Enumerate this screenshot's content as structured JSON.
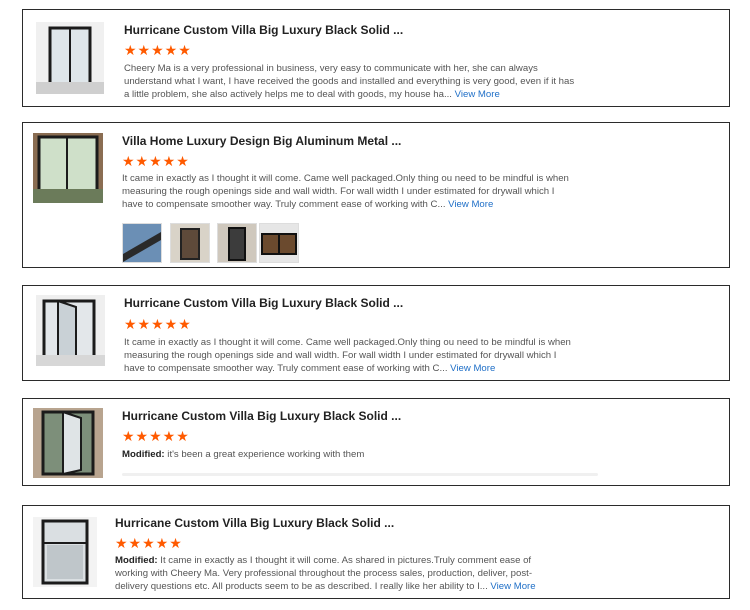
{
  "reviews": [
    {
      "title": "Hurricane Custom Villa Big Luxury Black Solid ...",
      "stars": "★★★★★",
      "modified_label": "",
      "text": "Cheery Ma is a very professional in business, very easy to communicate with her, she can always understand what I want, I have received the goods and installed and everything is very good, even if it has a little problem, she also actively helps me to deal with goods, my house ha...",
      "view_more": "View More"
    },
    {
      "title": "Villa Home Luxury Design Big Aluminum Metal ...",
      "stars": "★★★★★",
      "modified_label": "",
      "text": "It came in exactly as I thought it will come.  Came well packaged.Only thing ou need to be mindful is when measuring the rough openings side and wall width. For wall width I under estimated for drywall which I have to compensate smoother way.  Truly comment ease of working with C...",
      "view_more": "View More",
      "photos": [
        "photo-1",
        "photo-2",
        "photo-3",
        "photo-4"
      ]
    },
    {
      "title": "Hurricane Custom Villa Big Luxury Black Solid ...",
      "stars": "★★★★★",
      "modified_label": "",
      "text": "It came in exactly as I thought it will come.  Came well packaged.Only thing ou need to be mindful is when measuring the rough openings side and wall width. For wall width I under estimated for drywall which I have to compensate smoother way.  Truly comment ease of working with C...",
      "view_more": "View More"
    },
    {
      "title": "Hurricane Custom Villa Big Luxury Black Solid ...",
      "stars": "★★★★★",
      "modified_label": "Modified:",
      "text": " it's been a great experience working with them",
      "view_more": ""
    },
    {
      "title": "Hurricane Custom Villa Big Luxury Black Solid ...",
      "stars": "★★★★★",
      "modified_label": "Modified:",
      "text": " It came in exactly as I thought it will come. As shared in pictures.Truly comment ease of working with Cheery Ma. Very professional throughout the process sales, production, deliver, post-delivery questions etc. All products seem to be as described. I really like her ability to I...",
      "view_more": "View More"
    }
  ],
  "colors": {
    "star": "#ff5a00",
    "link": "#1f6fc7",
    "border": "#2b2b2b"
  }
}
